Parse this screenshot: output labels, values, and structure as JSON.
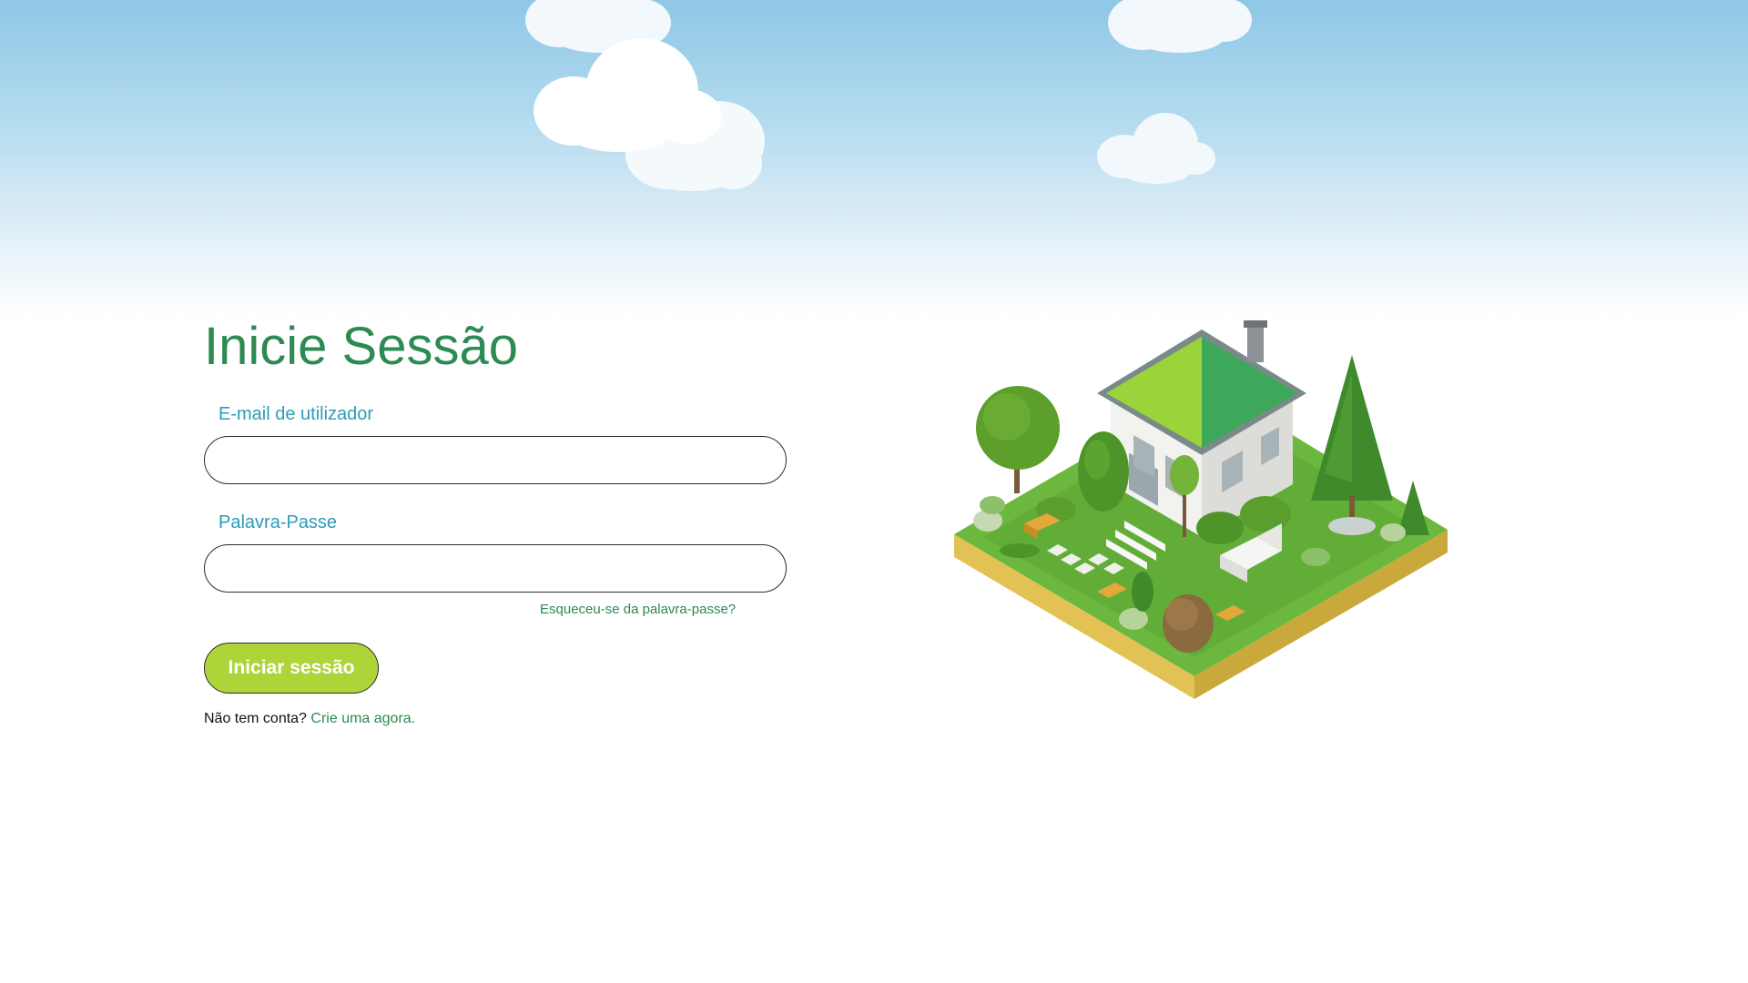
{
  "login": {
    "title": "Inicie Sessão",
    "email_label": "E-mail de utilizador",
    "email_value": "",
    "email_placeholder": "",
    "password_label": "Palavra-Passe",
    "password_value": "",
    "password_placeholder": "",
    "forgot_password_link": "Esqueceu-se da palavra-passe?",
    "submit_label": "Iniciar sessão",
    "signup_prompt": "Não tem conta?",
    "signup_link": "Crie uma agora."
  },
  "colors": {
    "title": "#2c8a52",
    "field_label": "#2d9cb6",
    "link": "#2c8a52",
    "button_bg": "#add53a",
    "sky_top": "#8fc7e6"
  },
  "icons": {
    "background": "sky-with-clouds",
    "illustration": "isometric-house-garden"
  }
}
